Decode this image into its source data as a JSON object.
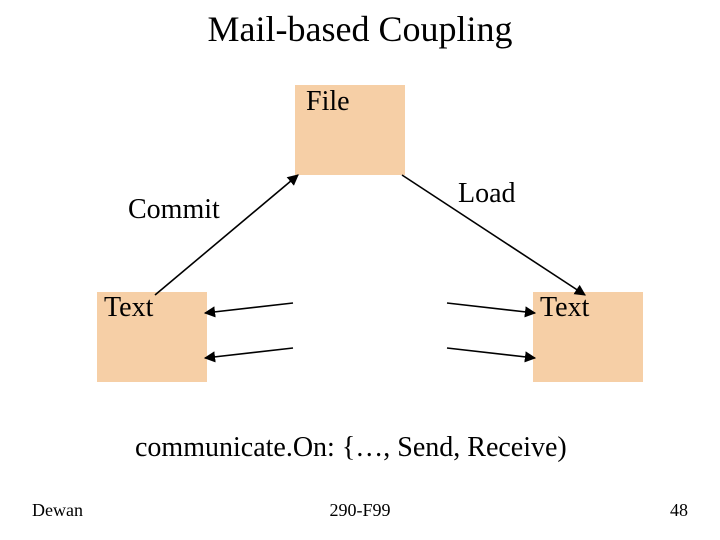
{
  "title": "Mail-based Coupling",
  "nodes": {
    "file": "File",
    "text_left": "Text",
    "text_right": "Text"
  },
  "edges": {
    "commit": "Commit",
    "load": "Load"
  },
  "caption": "communicate.On: {…, Send, Receive)",
  "footer": {
    "author": "Dewan",
    "course": "290-F99",
    "page": "48"
  },
  "colors": {
    "box_fill": "#f6cfa6",
    "line": "#000000"
  }
}
